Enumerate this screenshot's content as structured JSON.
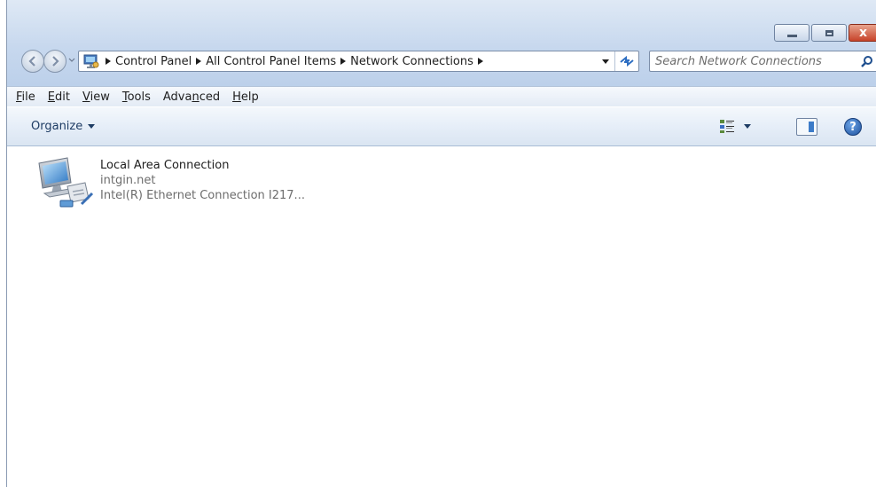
{
  "window": {
    "caption": {
      "minimize": "–",
      "maximize": "□",
      "close": "x"
    }
  },
  "nav": {
    "breadcrumbs": [
      "Control Panel",
      "All Control Panel Items",
      "Network Connections"
    ],
    "search_placeholder": "Search Network Connections"
  },
  "menu": {
    "items": [
      {
        "pre": "",
        "ul": "F",
        "post": "ile"
      },
      {
        "pre": "",
        "ul": "E",
        "post": "dit"
      },
      {
        "pre": "",
        "ul": "V",
        "post": "iew"
      },
      {
        "pre": "",
        "ul": "T",
        "post": "ools"
      },
      {
        "pre": "Adva",
        "ul": "n",
        "post": "ced"
      },
      {
        "pre": "",
        "ul": "H",
        "post": "elp"
      }
    ]
  },
  "toolbar": {
    "organize_label": "Organize",
    "help_label": "?"
  },
  "connections": [
    {
      "name": "Local Area Connection",
      "network": "intgin.net",
      "adapter": "Intel(R) Ethernet Connection I217..."
    }
  ],
  "colors": {
    "accent": "#3c7bc8",
    "muted_text": "#6d6d6d",
    "close_button": "#c7432a"
  }
}
